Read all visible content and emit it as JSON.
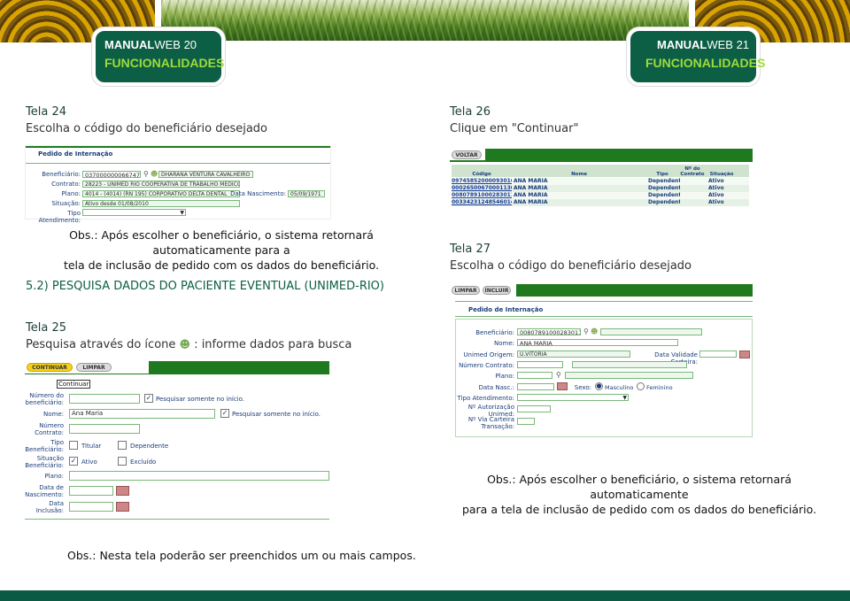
{
  "header": {
    "left": {
      "brand_bold": "MANUAL",
      "brand_light": "WEB",
      "page": "20",
      "subtitle": "FUNCIONALIDADES"
    },
    "right": {
      "brand_bold": "MANUAL",
      "brand_light": "WEB",
      "page": "21",
      "subtitle": "FUNCIONALIDADES"
    }
  },
  "left_page": {
    "tela24": {
      "title": "Tela 24",
      "caption": "Escolha o código do beneficiário desejado"
    },
    "shot24": {
      "heading": "Pedido de Internação",
      "fields": [
        {
          "label": "Beneficiário:",
          "code": "037000000066747",
          "value": "DHARANA VENTURA CAVALHEIRO"
        },
        {
          "label": "Contrato:",
          "value": "28223 - UNIMED RIO COOPERATIVA DE TRABALHO MEDICO DO"
        },
        {
          "label": "Plano:",
          "value": "4014 - (4014) (RN 195) CORPORATIVO DELTA DENTAL"
        },
        {
          "label": "Situação:",
          "value": "Ativo desde 01/08/2010"
        },
        {
          "label": "Tipo Atendimento:",
          "value": ""
        }
      ],
      "birth_label": "Data Nascimento:",
      "birth_value": "05/09/1971"
    },
    "obs1_line1": "Obs.: Após escolher o beneficiário, o sistema retornará automaticamente para a",
    "obs1_line2": "tela de inclusão de pedido com os dados do beneficiário.",
    "section_title": "5.2) PESQUISA DADOS DO PACIENTE EVENTUAL (UNIMED-RIO)",
    "tela25": {
      "title": "Tela 25",
      "caption_a": "Pesquisa através do ícone",
      "caption_b": ": informe dados para busca"
    },
    "shot25": {
      "btn_continuar": "CONTINUAR",
      "btn_limpar": "LIMPAR",
      "tooltip": "Continuar",
      "rows": [
        {
          "label1": "Número do",
          "label2": "beneficiário:",
          "value": "",
          "check": "Pesquisar somente no início."
        },
        {
          "label1": "Nome:",
          "label2": "",
          "value": "Ana Maria",
          "check": "Pesquisar somente no início."
        },
        {
          "label1": "Número",
          "label2": "Contrato:",
          "value": ""
        },
        {
          "label1": "Tipo",
          "label2": "Beneficiário:",
          "opt1": "Titular",
          "opt2": "Dependente"
        },
        {
          "label1": "Situação",
          "label2": "Beneficiário:",
          "opt1": "Ativo",
          "opt2": "Excluído"
        },
        {
          "label1": "Plano:",
          "label2": ""
        },
        {
          "label1": "Data de",
          "label2": "Nascimento:"
        },
        {
          "label1": "Data",
          "label2": "Inclusão:"
        }
      ]
    },
    "obs2": "Obs.: Nesta tela poderão ser preenchidos um ou mais campos."
  },
  "right_page": {
    "tela26": {
      "title": "Tela 26",
      "caption": "Clique em \"Continuar\""
    },
    "shot26": {
      "btn_voltar": "VOLTAR",
      "columns": [
        "Código",
        "Nome",
        "Tipo",
        "Nº do Contrato",
        "Situação"
      ],
      "rows": [
        [
          "09745852000093016",
          "ANA MARIA",
          "Dependente",
          "",
          "Ativo"
        ],
        [
          "00026500670001130",
          "ANA MARIA",
          "Dependente",
          "",
          "Ativo"
        ],
        [
          "00807891000283011",
          "ANA MARIA",
          "Dependente",
          "",
          "Ativo"
        ],
        [
          "00334231248546014",
          "ANA MARIA",
          "Dependente",
          "",
          "Ativo"
        ]
      ]
    },
    "tela27": {
      "title": "Tela 27",
      "caption": "Escolha o código do beneficiário desejado"
    },
    "shot27": {
      "btn_limpar": "LIMPAR",
      "btn_incluir": "INCLUIR",
      "heading": "Pedido de Internação",
      "beneficiario_label": "Beneficiário:",
      "beneficiario_value": "00807891000283011",
      "nome_label": "Nome:",
      "nome_value": "ANA MARIA",
      "origem_label": "Unimed Origem:",
      "origem_value": "U.VITORIA",
      "validade_label": "Data Validade Carteira:",
      "contrato_label": "Número Contrato:",
      "plano_label": "Plano:",
      "nasc_label": "Data Nasc.:",
      "sexo_label": "Sexo:",
      "sexo_m": "Masculino",
      "sexo_f": "Feminino",
      "tipo_label": "Tipo Atendimento:",
      "autorizacao_label1": "Nº Autorização",
      "autorizacao_label2": "Unimed:",
      "via_label1": "Nº Via Carteira",
      "via_label2": "Transação:"
    },
    "obs_line1": "Obs.: Após escolher o beneficiário, o sistema retornará automaticamente",
    "obs_line2": "para a tela de inclusão de pedido com os dados do beneficiário."
  },
  "colors": {
    "brand_green": "#0c5e45",
    "accent_lime": "#9fdc3a",
    "form_green": "#1f7a1f",
    "link_blue": "#1a3d7a"
  }
}
